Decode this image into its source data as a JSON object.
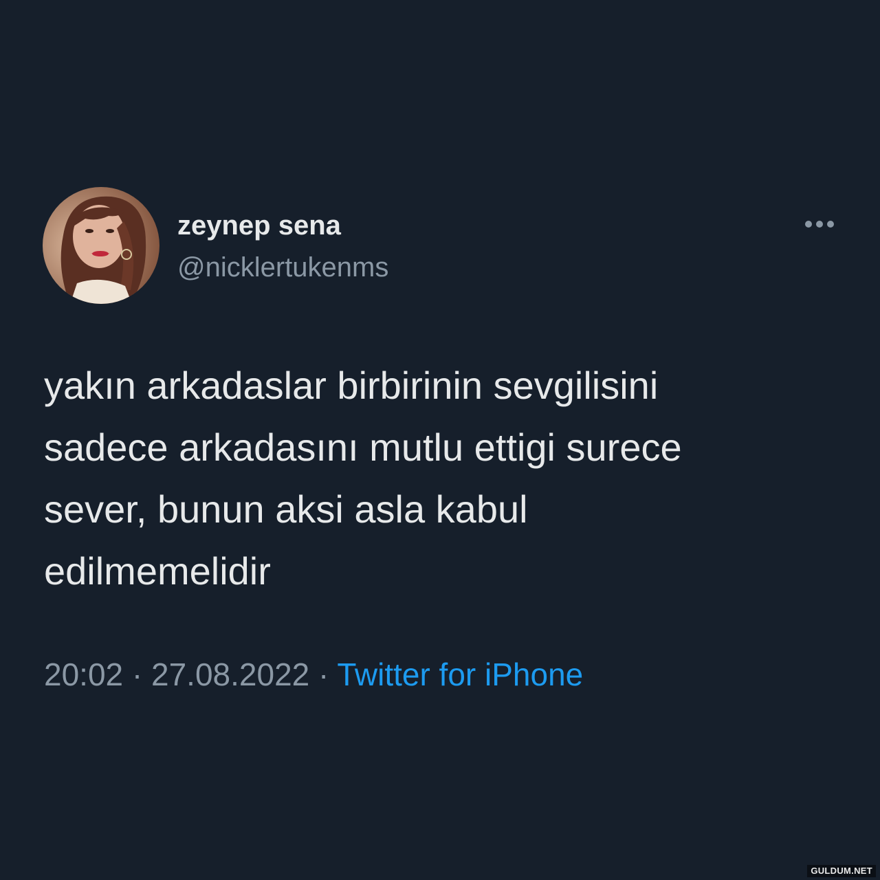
{
  "tweet": {
    "author": {
      "display_name": "zeynep sena",
      "handle": "@nicklertukenms",
      "avatar_icon": "profile-photo"
    },
    "more_icon": "more-horizontal-icon",
    "text_lines": [
      "yakın arkadaslar birbirinin sevgilisini",
      "sadece arkadasını mutlu ettigi surece",
      "sever, bunun aksi asla kabul",
      "edilmemelidir"
    ],
    "time": "20:02",
    "separator": "·",
    "date": "27.08.2022",
    "source": "Twitter for iPhone"
  },
  "watermark": "GULDUM.NET",
  "colors": {
    "background": "#161f2b",
    "primary_text": "#e7e9ea",
    "secondary_text": "#8b98a5",
    "link": "#1d9bf0"
  }
}
